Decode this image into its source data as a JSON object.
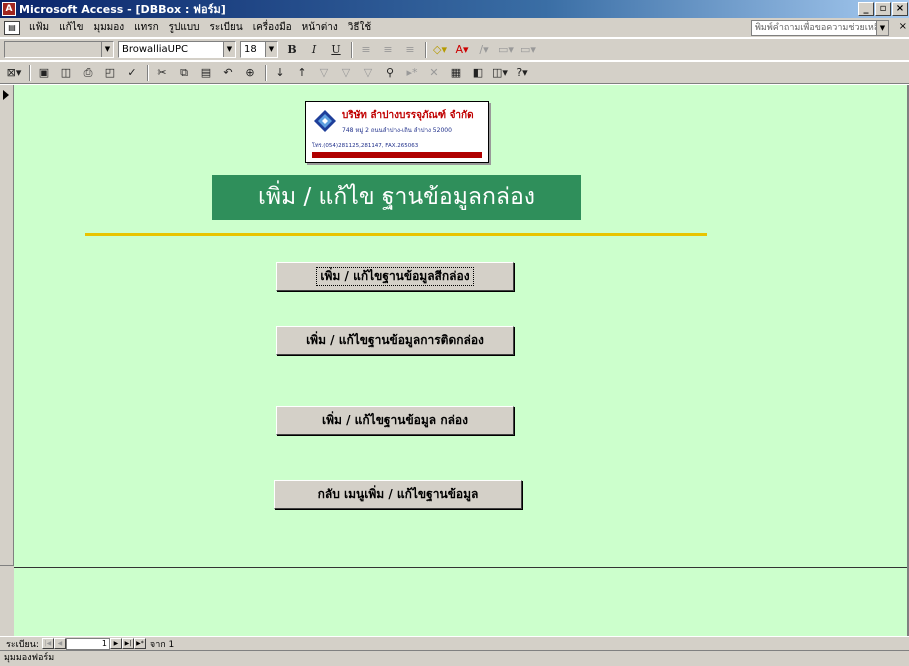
{
  "window": {
    "title": "Microsoft Access - [DBBox : ฟอร์ม]",
    "app_icon": "access-icon"
  },
  "menubar": {
    "items": [
      "แฟ้ม",
      "แก้ไข",
      "มุมมอง",
      "แทรก",
      "รูปแบบ",
      "ระเบียน",
      "เครื่องมือ",
      "หน้าต่าง",
      "วิธีใช้"
    ],
    "help_placeholder": "พิมพ์คำถามเพื่อขอความช่วยเหลือ"
  },
  "toolbar_format": {
    "font_name": "BrowalliaUPC",
    "font_size": "18",
    "bold": "B",
    "italic": "I",
    "underline": "U"
  },
  "form": {
    "logo": {
      "company": "บริษัท ลำปางบรรจุภัณฑ์ จำกัด",
      "address": "748 หมู่ 2 ถนนลำปาง-เถิน ลำปาง 52000",
      "phone": "โทร.(054)281125,281147, FAX.265063"
    },
    "title": "เพิ่ม / แก้ไข ฐานข้อมูลกล่อง",
    "buttons": [
      "เพิ่ม / แก้ไขฐานข้อมูลสีกล่อง",
      "เพิ่ม / แก้ไขฐานข้อมูลการติดกล่อง",
      "เพิ่ม / แก้ไขฐานข้อมูล กล่อง",
      "กลับ เมนูเพิ่ม / แก้ไขฐานข้อมูล"
    ]
  },
  "navigation": {
    "label": "ระเบียน:",
    "current": "1",
    "of_label": "จาก 1"
  },
  "status": {
    "text": "มุมมองฟอร์ม"
  },
  "colors": {
    "form_background": "#ccffcc",
    "banner": "#2f8f5b",
    "accent_line": "#e8c400"
  }
}
